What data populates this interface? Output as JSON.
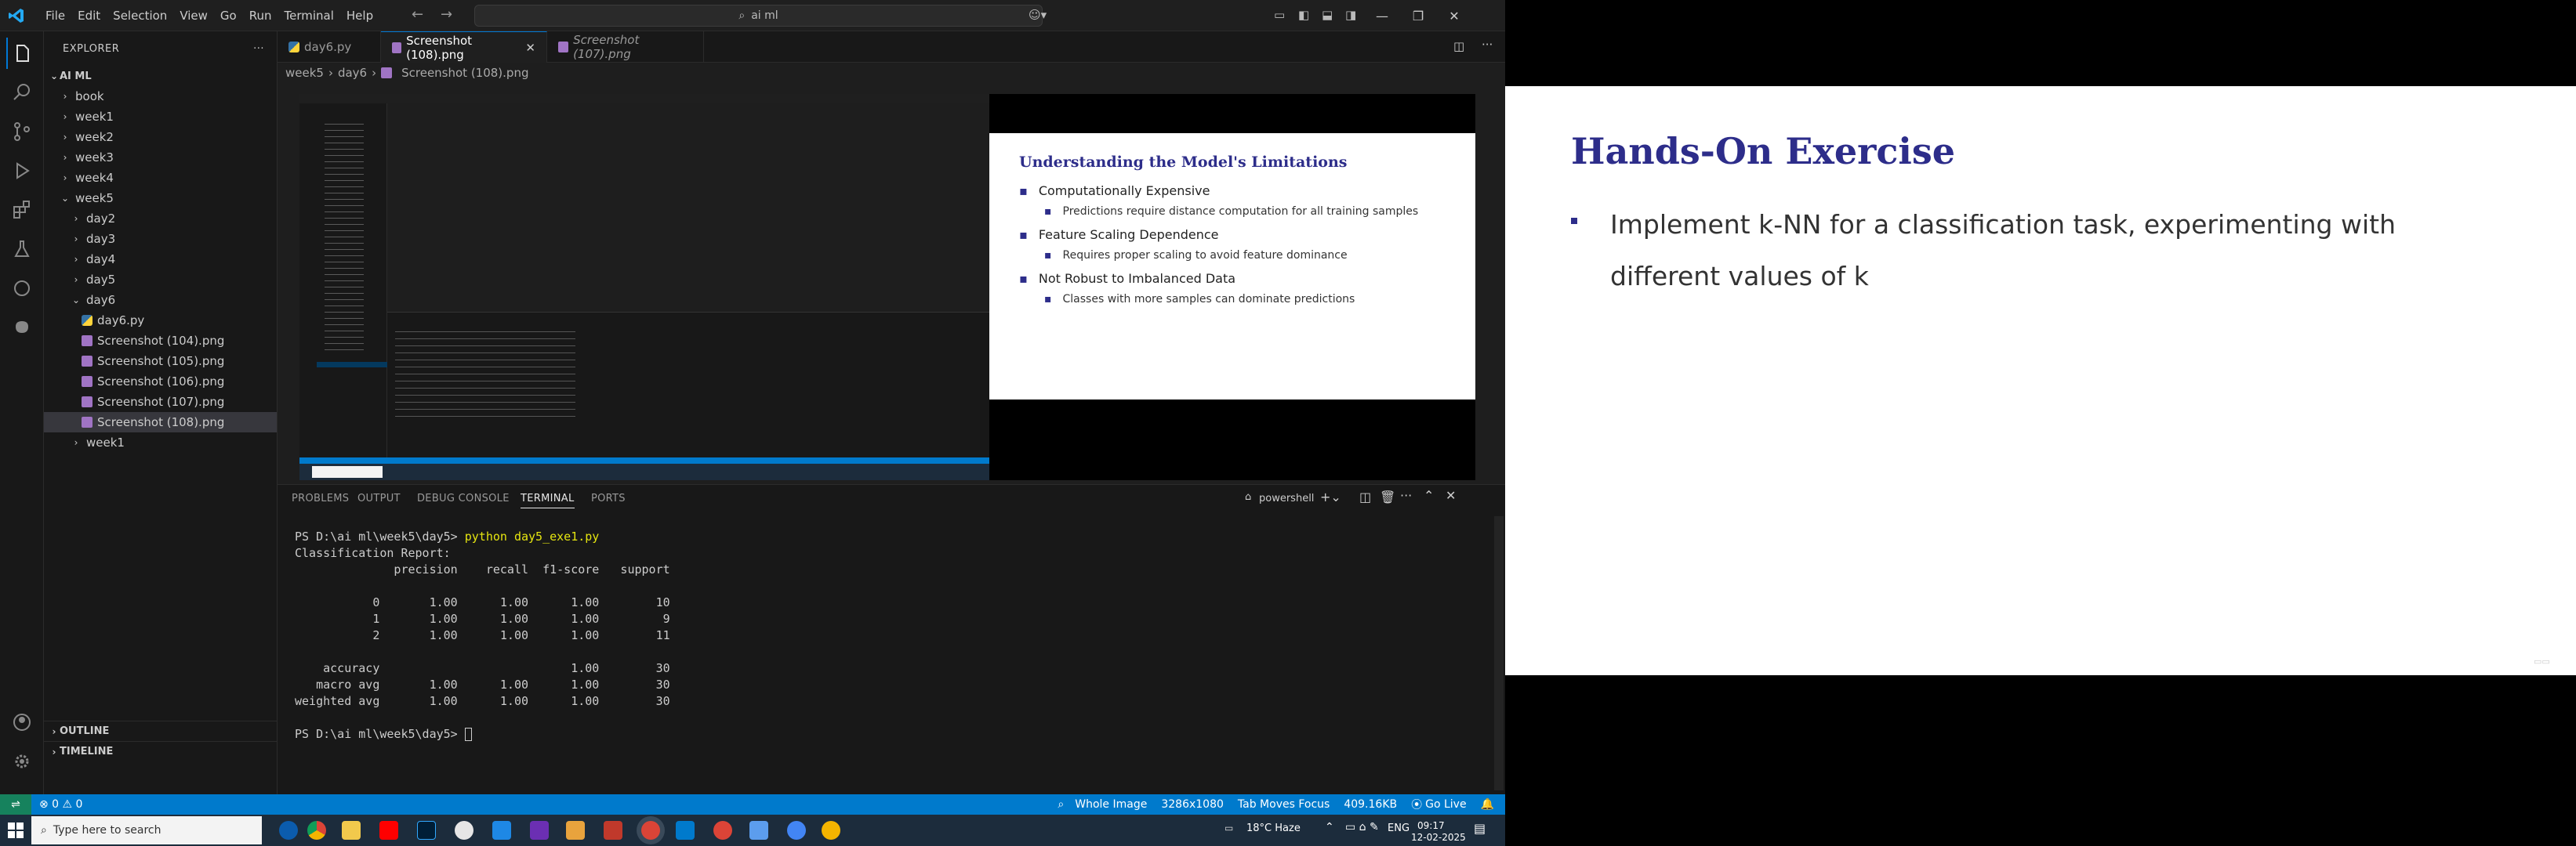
{
  "titlebar": {
    "menu": [
      "File",
      "Edit",
      "Selection",
      "View",
      "Go",
      "Run",
      "Terminal",
      "Help"
    ],
    "search_text": "ai ml",
    "controls": [
      "—",
      "❐",
      "✕"
    ]
  },
  "sidebar": {
    "header": "EXPLORER",
    "root": "AI ML",
    "items": [
      {
        "label": "book",
        "depth": 1,
        "kind": "folder",
        "open": false
      },
      {
        "label": "week1",
        "depth": 1,
        "kind": "folder",
        "open": false
      },
      {
        "label": "week2",
        "depth": 1,
        "kind": "folder",
        "open": false
      },
      {
        "label": "week3",
        "depth": 1,
        "kind": "folder",
        "open": false
      },
      {
        "label": "week4",
        "depth": 1,
        "kind": "folder",
        "open": false
      },
      {
        "label": "week5",
        "depth": 1,
        "kind": "folder",
        "open": true
      },
      {
        "label": "day2",
        "depth": 2,
        "kind": "folder",
        "open": false
      },
      {
        "label": "day3",
        "depth": 2,
        "kind": "folder",
        "open": false
      },
      {
        "label": "day4",
        "depth": 2,
        "kind": "folder",
        "open": false
      },
      {
        "label": "day5",
        "depth": 2,
        "kind": "folder",
        "open": false
      },
      {
        "label": "day6",
        "depth": 2,
        "kind": "folder",
        "open": true
      },
      {
        "label": "day6.py",
        "depth": 3,
        "kind": "py"
      },
      {
        "label": "Screenshot (104).png",
        "depth": 3,
        "kind": "img"
      },
      {
        "label": "Screenshot (105).png",
        "depth": 3,
        "kind": "img"
      },
      {
        "label": "Screenshot (106).png",
        "depth": 3,
        "kind": "img"
      },
      {
        "label": "Screenshot (107).png",
        "depth": 3,
        "kind": "img"
      },
      {
        "label": "Screenshot (108).png",
        "depth": 3,
        "kind": "img",
        "selected": true
      },
      {
        "label": "week1",
        "depth": 2,
        "kind": "folder",
        "open": false
      }
    ],
    "outline": "OUTLINE",
    "timeline": "TIMELINE"
  },
  "tabs": [
    {
      "label": "day6.py",
      "active": false
    },
    {
      "label": "Screenshot (108).png",
      "active": true
    },
    {
      "label": "Screenshot (107).png",
      "active": false
    }
  ],
  "breadcrumb": [
    "week5",
    "day6",
    "Screenshot (108).png"
  ],
  "slide_small": {
    "title": "Understanding the Model's Limitations",
    "bullets": [
      {
        "text": "Computationally Expensive",
        "sub": "Predictions require distance computation for all training samples"
      },
      {
        "text": "Feature Scaling Dependence",
        "sub": "Requires proper scaling to avoid feature dominance"
      },
      {
        "text": "Not Robust to Imbalanced Data",
        "sub": "Classes with more samples can dominate predictions"
      }
    ]
  },
  "panel": {
    "tabs": [
      "PROBLEMS",
      "OUTPUT",
      "DEBUG CONSOLE",
      "TERMINAL",
      "PORTS"
    ],
    "shell": "powershell",
    "terminal": {
      "prompt1": "PS D:\\ai ml\\week5\\day5> ",
      "cmd": "python day5_exe1.py",
      "lines": [
        "Classification Report:",
        "              precision    recall  f1-score   support",
        "",
        "           0       1.00      1.00      1.00        10",
        "           1       1.00      1.00      1.00         9",
        "           2       1.00      1.00      1.00        11",
        "",
        "    accuracy                           1.00        30",
        "   macro avg       1.00      1.00      1.00        30",
        "weighted avg       1.00      1.00      1.00        30",
        ""
      ],
      "prompt2": "PS D:\\ai ml\\week5\\day5> "
    }
  },
  "status": {
    "left": "⊗ 0 ⚠ 0",
    "items": [
      "Whole Image",
      "3286x1080",
      "Tab Moves Focus",
      "409.16KB",
      "Go Live"
    ]
  },
  "taskbar": {
    "search": "Type here to search",
    "weather": "18°C  Haze",
    "lang": "ENG",
    "time": "09:17",
    "date": "12-02-2025"
  },
  "slide_big": {
    "title": "Hands-On Exercise",
    "bullet": "Implement k-NN for a classification task, experimenting with different values of k"
  },
  "colors": {
    "accent": "#007acc",
    "slide_title": "#2d2d8a"
  }
}
